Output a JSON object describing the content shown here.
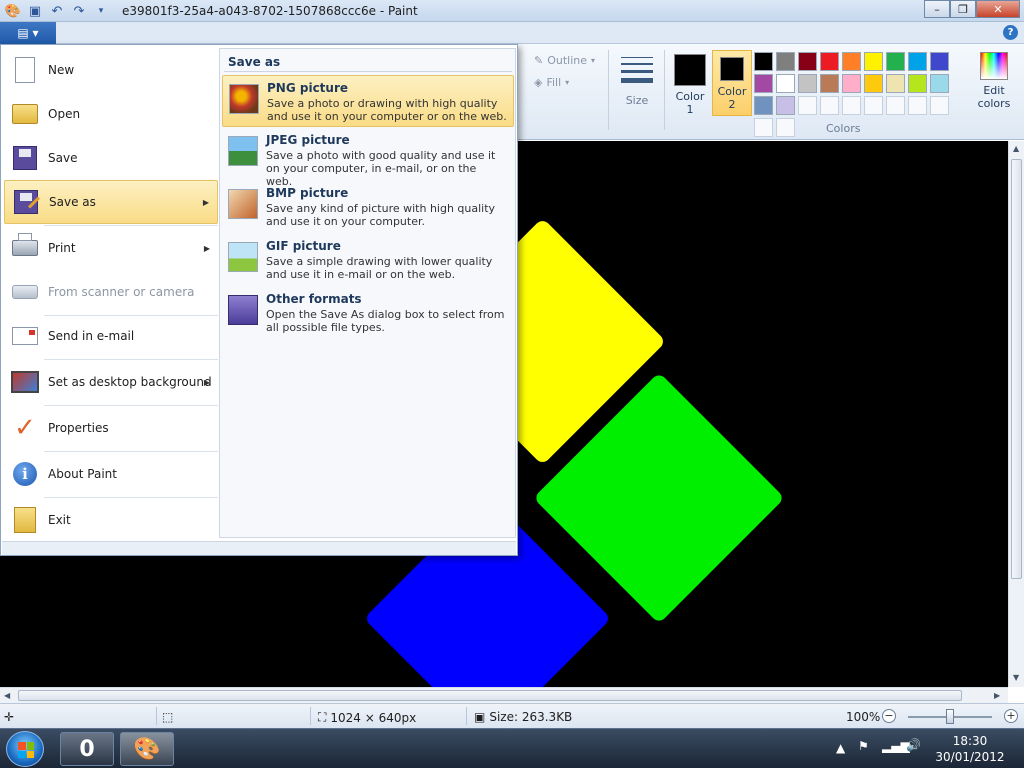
{
  "window": {
    "title": "e39801f3-25a4-a043-8702-1507868ccc6e - Paint",
    "minimize": "–",
    "maximize": "❐",
    "close": "✕"
  },
  "ribbon": {
    "app_button": "▤ ▾",
    "help": "?",
    "outline_label": "Outline",
    "fill_label": "Fill",
    "size_label": "Size",
    "color1_label": "Color",
    "color1_num": "1",
    "color2_label": "Color",
    "color2_num": "2",
    "edit_colors_label": "Edit",
    "edit_colors_label2": "colors",
    "colors_group_label": "Colors",
    "palette_row1": [
      "#000000",
      "#7f7f7f",
      "#880015",
      "#ed1c24",
      "#ff7f27",
      "#fff200",
      "#22b14c",
      "#00a2e8",
      "#3f48cc",
      "#a349a4"
    ],
    "palette_row2": [
      "#ffffff",
      "#c3c3c3",
      "#b97a57",
      "#ffaec9",
      "#ffc90e",
      "#efe4b0",
      "#b5e61d",
      "#99d9ea",
      "#7092be",
      "#c8bfe7"
    ]
  },
  "file_menu": {
    "items": [
      {
        "label": "New",
        "icon": "new-page-icon"
      },
      {
        "label": "Open",
        "icon": "open-folder-icon"
      },
      {
        "label": "Save",
        "icon": "floppy-disk-icon"
      },
      {
        "label": "Save as",
        "icon": "save-as-icon"
      },
      {
        "label": "Print",
        "icon": "printer-icon"
      },
      {
        "label": "From scanner or camera",
        "icon": "scanner-icon"
      },
      {
        "label": "Send in e-mail",
        "icon": "email-icon"
      },
      {
        "label": "Set as desktop background",
        "icon": "desktop-icon"
      },
      {
        "label": "Properties",
        "icon": "checkmark-icon"
      },
      {
        "label": "About Paint",
        "icon": "info-icon"
      },
      {
        "label": "Exit",
        "icon": "exit-icon"
      }
    ],
    "save_as": {
      "heading": "Save as",
      "options": [
        {
          "title": "PNG picture",
          "desc": "Save a photo or drawing with high quality and use it on your computer or on the web."
        },
        {
          "title": "JPEG picture",
          "desc": "Save a photo with good quality and use it on your computer, in e-mail, or on the web."
        },
        {
          "title": "BMP picture",
          "desc": "Save any kind of picture with high quality and use it on your computer."
        },
        {
          "title": "GIF picture",
          "desc": "Save a simple drawing with lower quality and use it in e-mail or on the web."
        },
        {
          "title": "Other formats",
          "desc": "Open the Save As dialog box to select from all possible file types."
        }
      ]
    }
  },
  "status": {
    "dimensions": "1024 × 640px",
    "size": "Size: 263.3KB",
    "zoom": "100%",
    "zoom_level_percent": 100
  },
  "taskbar": {
    "app1_label": "0",
    "time": "18:30",
    "date": "30/01/2012"
  }
}
